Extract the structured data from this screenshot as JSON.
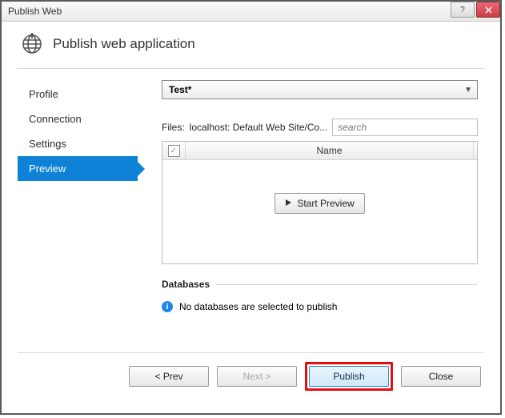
{
  "window": {
    "title": "Publish Web"
  },
  "header": {
    "title": "Publish web application"
  },
  "sidebar": {
    "items": [
      {
        "label": "Profile"
      },
      {
        "label": "Connection"
      },
      {
        "label": "Settings"
      },
      {
        "label": "Preview"
      }
    ]
  },
  "profile": {
    "selected": "Test*"
  },
  "files": {
    "label": "Files:",
    "path": "localhost: Default Web Site/Co...",
    "search_placeholder": "search",
    "column_name": "Name",
    "start_preview": "Start Preview"
  },
  "databases": {
    "heading": "Databases",
    "info": "No databases are selected to publish"
  },
  "footer": {
    "prev": "< Prev",
    "next": "Next >",
    "publish": "Publish",
    "close": "Close"
  }
}
